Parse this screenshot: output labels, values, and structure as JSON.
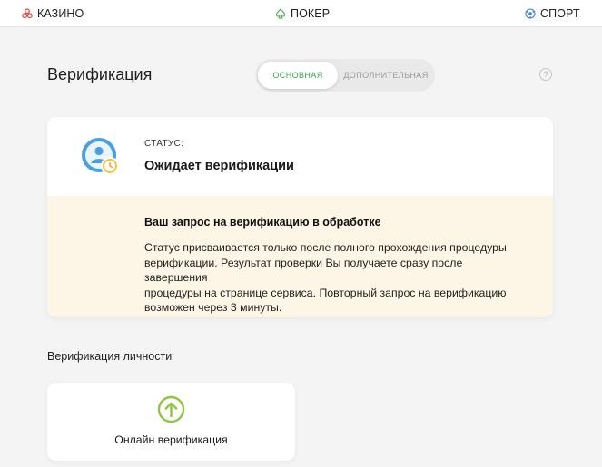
{
  "topnav": {
    "casino_label": "КАЗИНО",
    "poker_label": "ПОКЕР",
    "sport_label": "СПОРТ"
  },
  "header": {
    "title": "Верификация",
    "tabs": [
      {
        "label": "ОСНОВНАЯ",
        "active": true
      },
      {
        "label": "ДОПОЛНИТЕЛЬНАЯ",
        "active": false
      }
    ],
    "help_label": "?"
  },
  "status_card": {
    "label": "СТАТУС:",
    "value": "Ожидает верификации",
    "notice_title": "Ваш запрос на верификацию в обработке",
    "notice_lines": [
      "Статус присваивается только после полного прохождения процедуры",
      "верификации. Результат проверки Вы получаете сразу после завершения",
      "процедуры на странице сервиса. Повторный запрос на верификацию",
      "возможен через 3 минуты."
    ]
  },
  "identity": {
    "section_title": "Верификация личности",
    "method_label": "Онлайн верификация"
  },
  "colors": {
    "accent_green": "#3aa64a",
    "icon_green": "#8cc63f",
    "notice_bg": "#fdf5e6",
    "status_blue": "#4a9fe0",
    "clock_yellow": "#f7c43d"
  }
}
